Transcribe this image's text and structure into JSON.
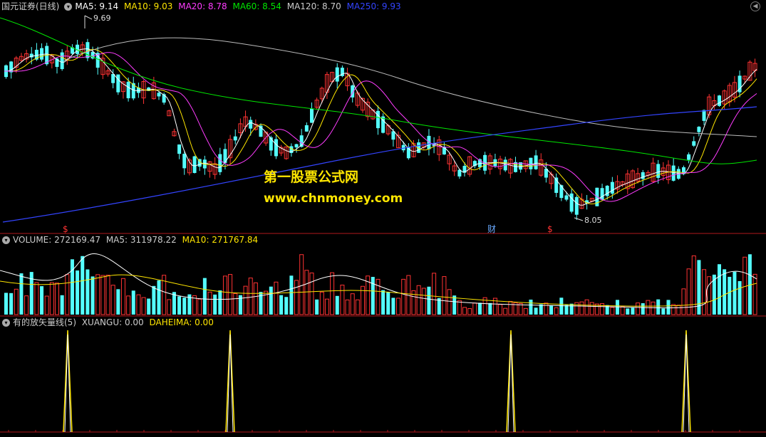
{
  "header": {
    "stock_name": "国元证券(日线)",
    "ma5": {
      "label": "MA5: 9.14",
      "color": "#ffffff"
    },
    "ma10": {
      "label": "MA10: 9.03",
      "color": "#ffe600"
    },
    "ma20": {
      "label": "MA20: 8.78",
      "color": "#ff3cff"
    },
    "ma60": {
      "label": "MA60: 8.54",
      "color": "#00e600"
    },
    "ma120": {
      "label": "MA120: 8.70",
      "color": "#cccccc"
    },
    "ma250": {
      "label": "MA250: 9.93",
      "color": "#3344ff"
    }
  },
  "volume_header": {
    "volume": {
      "label": "VOLUME: 272169.47",
      "color": "#cccccc"
    },
    "ma5": {
      "label": "MA5: 311978.22",
      "color": "#cccccc"
    },
    "ma10": {
      "label": "MA10: 271767.84",
      "color": "#ffe600"
    }
  },
  "indicator_header": {
    "name": {
      "label": "有的放矢量线(5)",
      "color": "#cccccc"
    },
    "xuangu": {
      "label": "XUANGU: 0.00",
      "color": "#cccccc"
    },
    "daheima": {
      "label": "DAHEIMA: 0.00",
      "color": "#ffe600"
    }
  },
  "annotations": {
    "high_label": "9.69",
    "low_label": "8.05",
    "markers": [
      "$",
      "财",
      "$"
    ]
  },
  "watermark": {
    "line1": "第一股票公式网",
    "line2": "www.chnmoney.com"
  },
  "colors": {
    "up": "#ff3333",
    "down": "#54ffff",
    "divider": "#b0181b",
    "background": "#000000"
  },
  "chart_data": [
    {
      "type": "candlestick",
      "series": [
        {
          "name": "MA5",
          "value": 9.14
        },
        {
          "name": "MA10",
          "value": 9.03
        },
        {
          "name": "MA20",
          "value": 8.78
        },
        {
          "name": "MA60",
          "value": 8.54
        },
        {
          "name": "MA120",
          "value": 8.7
        },
        {
          "name": "MA250",
          "value": 9.93
        }
      ],
      "high": 9.69,
      "low": 8.05,
      "ylim": [
        7.9,
        9.85
      ]
    },
    {
      "type": "bar",
      "series": [
        {
          "name": "VOLUME",
          "value": 272169.47
        },
        {
          "name": "MA5",
          "value": 311978.22
        },
        {
          "name": "MA10",
          "value": 271767.84
        }
      ]
    },
    {
      "type": "line",
      "series": [
        {
          "name": "XUANGU",
          "value": 0.0
        },
        {
          "name": "DAHEIMA",
          "value": 0.0
        }
      ],
      "spike_positions": [
        95,
        323,
        717,
        963
      ]
    }
  ]
}
